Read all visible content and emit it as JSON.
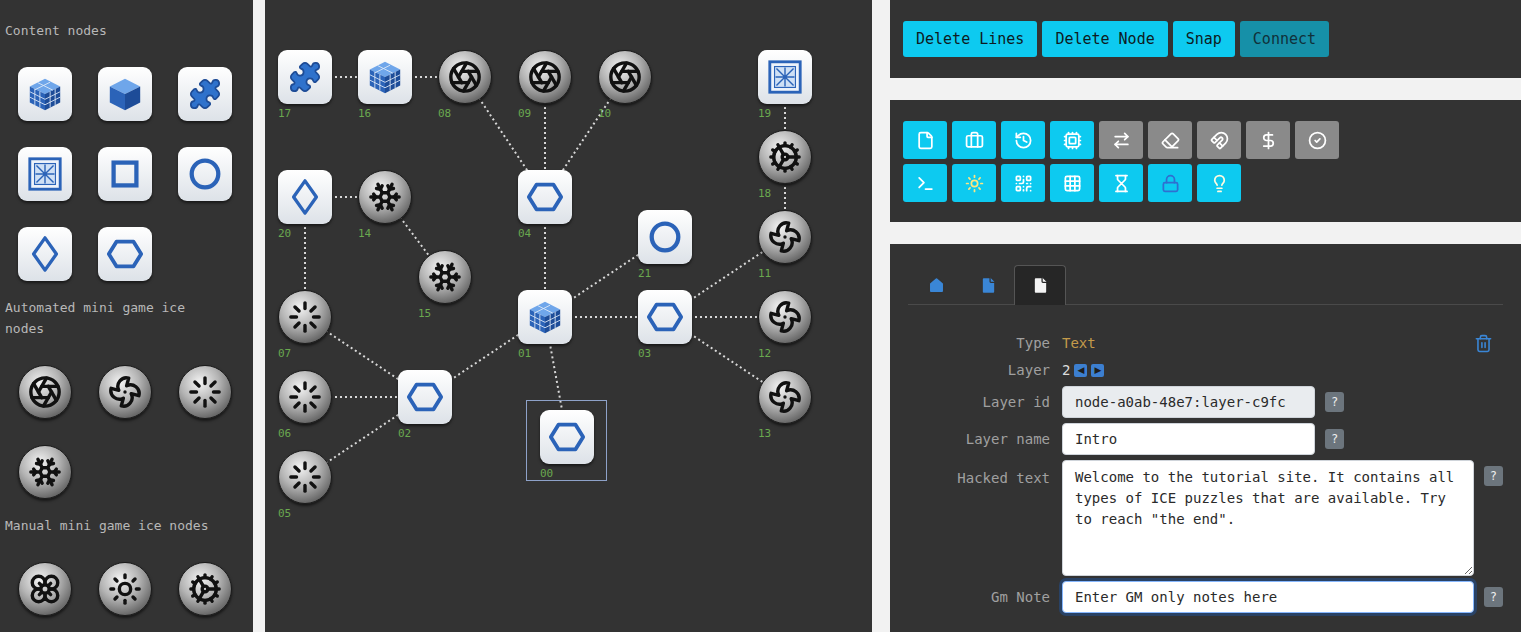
{
  "palette": [
    {
      "title": "Content nodes",
      "items": [
        {
          "kind": "cube-grid"
        },
        {
          "kind": "cube"
        },
        {
          "kind": "puzzle"
        },
        {
          "kind": "framed"
        },
        {
          "kind": "square"
        },
        {
          "kind": "ring"
        },
        {
          "kind": "diamond"
        },
        {
          "kind": "hexagon"
        }
      ]
    },
    {
      "title": "Automated mini game ice nodes",
      "items": [
        {
          "kind": "aperture"
        },
        {
          "kind": "pinwheel"
        },
        {
          "kind": "swirl"
        },
        {
          "kind": "snowflake"
        }
      ]
    },
    {
      "title": "Manual mini game ice nodes",
      "items": [
        {
          "kind": "flower"
        },
        {
          "kind": "rosette"
        },
        {
          "kind": "mandala"
        }
      ]
    }
  ],
  "canvas": {
    "nodes": [
      {
        "label": "00",
        "kind": "hexagon",
        "selected": true
      },
      {
        "label": "01",
        "kind": "cube-grid",
        "selected": false
      },
      {
        "label": "02",
        "kind": "hexagon",
        "selected": false
      },
      {
        "label": "03",
        "kind": "hexagon",
        "selected": false
      },
      {
        "label": "04",
        "kind": "hexagon",
        "selected": false
      },
      {
        "label": "05",
        "kind": "swirl",
        "selected": false
      },
      {
        "label": "06",
        "kind": "swirl",
        "selected": false
      },
      {
        "label": "07",
        "kind": "swirl",
        "selected": false
      },
      {
        "label": "08",
        "kind": "aperture",
        "selected": false
      },
      {
        "label": "09",
        "kind": "aperture",
        "selected": false
      },
      {
        "label": "10",
        "kind": "aperture",
        "selected": false
      },
      {
        "label": "11",
        "kind": "pinwheel",
        "selected": false
      },
      {
        "label": "12",
        "kind": "pinwheel",
        "selected": false
      },
      {
        "label": "13",
        "kind": "pinwheel",
        "selected": false
      },
      {
        "label": "14",
        "kind": "snowflake",
        "selected": false
      },
      {
        "label": "15",
        "kind": "snowflake",
        "selected": false
      },
      {
        "label": "16",
        "kind": "cube-grid",
        "selected": false
      },
      {
        "label": "17",
        "kind": "puzzle",
        "selected": false
      },
      {
        "label": "18",
        "kind": "mandala",
        "selected": false
      },
      {
        "label": "19",
        "kind": "framed",
        "selected": false
      },
      {
        "label": "20",
        "kind": "diamond",
        "selected": false
      },
      {
        "label": "21",
        "kind": "ring",
        "selected": false
      }
    ],
    "edges": [
      {
        "from": "17",
        "to": "16"
      },
      {
        "from": "16",
        "to": "08"
      },
      {
        "from": "08",
        "to": "04"
      },
      {
        "from": "09",
        "to": "04"
      },
      {
        "from": "10",
        "to": "04"
      },
      {
        "from": "04",
        "to": "01"
      },
      {
        "from": "20",
        "to": "14"
      },
      {
        "from": "14",
        "to": "15"
      },
      {
        "from": "20",
        "to": "07"
      },
      {
        "from": "07",
        "to": "02"
      },
      {
        "from": "06",
        "to": "02"
      },
      {
        "from": "05",
        "to": "02"
      },
      {
        "from": "02",
        "to": "01"
      },
      {
        "from": "01",
        "to": "21"
      },
      {
        "from": "01",
        "to": "03"
      },
      {
        "from": "01",
        "to": "00"
      },
      {
        "from": "03",
        "to": "11"
      },
      {
        "from": "03",
        "to": "12"
      },
      {
        "from": "03",
        "to": "13"
      },
      {
        "from": "19",
        "to": "18"
      },
      {
        "from": "18",
        "to": "11"
      }
    ]
  },
  "toolbar": {
    "buttons": [
      {
        "label": "Delete Lines",
        "selected": false
      },
      {
        "label": "Delete Node",
        "selected": false
      },
      {
        "label": "Snap",
        "selected": false
      },
      {
        "label": "Connect",
        "selected": true
      }
    ]
  },
  "layer_types": {
    "rows": [
      [
        {
          "enabled": true
        },
        {
          "enabled": true
        },
        {
          "enabled": true
        },
        {
          "enabled": true
        },
        {
          "enabled": false
        },
        {
          "enabled": false
        },
        {
          "enabled": false
        },
        {
          "enabled": false
        },
        {
          "enabled": false
        }
      ],
      [
        {
          "enabled": true
        },
        {
          "enabled": true
        },
        {
          "enabled": true
        },
        {
          "enabled": true
        },
        {
          "enabled": true
        },
        {
          "enabled": true
        },
        {
          "enabled": true
        }
      ]
    ]
  },
  "details": {
    "tabs": [
      {
        "selected": false
      },
      {
        "selected": false
      },
      {
        "selected": true
      }
    ],
    "fields": [
      {
        "label": "Type",
        "kind": "value",
        "value": "Text"
      },
      {
        "label": "Layer",
        "kind": "stepper",
        "value": "2",
        "prev": "◀",
        "next": "▶"
      },
      {
        "label": "Layer id",
        "kind": "short-input",
        "value": "node-a0ab-48e7:layer-c9fc",
        "disabled": true,
        "focused": false,
        "help": "?"
      },
      {
        "label": "Layer name",
        "kind": "short-input",
        "value": "Intro",
        "disabled": false,
        "focused": false,
        "help": "?"
      },
      {
        "label": "Hacked text",
        "kind": "textarea",
        "value": "Welcome to the tutorial site. It contains all types of ICE puzzles that are available. Try to reach \"the end\".",
        "disabled": false,
        "focused": false,
        "help": "?"
      },
      {
        "label": "Gm Note",
        "kind": "long-input",
        "value": "Enter GM only notes here",
        "disabled": false,
        "focused": true,
        "help": "?"
      }
    ]
  }
}
